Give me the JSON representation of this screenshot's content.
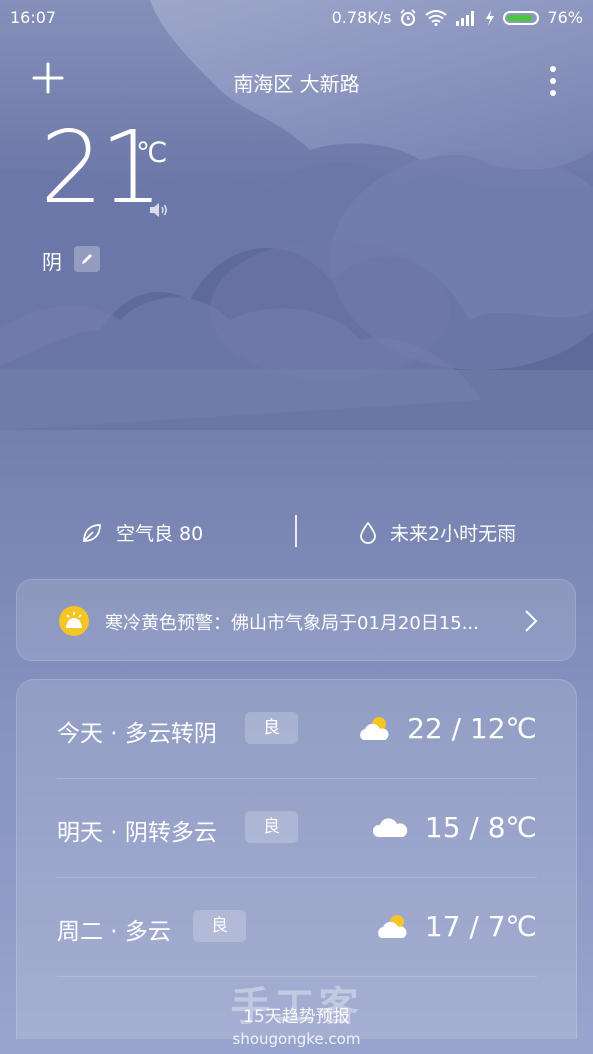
{
  "status": {
    "time": "16:07",
    "speed": "0.78K/s",
    "battery": "76%"
  },
  "header": {
    "location": "南海区 大新路"
  },
  "current": {
    "temp": "21",
    "unit": "℃",
    "condition": "阴"
  },
  "air": {
    "aqi": "空气良 80",
    "rain": "未来2小时无雨"
  },
  "alert": {
    "text": "寒冷黄色预警：佛山市气象局于01月20日15..."
  },
  "forecast": [
    {
      "label": "今天 · 多云转阴",
      "badge": "良",
      "icon": "sun-cloud-icon",
      "temps": "22  /  12℃"
    },
    {
      "label": "明天 · 阴转多云",
      "badge": "良",
      "icon": "cloud-icon",
      "temps": "15  /  8℃"
    },
    {
      "label": "周二 · 多云",
      "badge": "良",
      "icon": "sun-cloud-icon",
      "temps": "17  /  7℃"
    }
  ],
  "trend_label": "15天趋势预报",
  "watermark": {
    "big": "手工客",
    "small": "shougongke.com"
  },
  "colors": {
    "accent_alert": "#f5c425",
    "battery": "#46c93a"
  }
}
